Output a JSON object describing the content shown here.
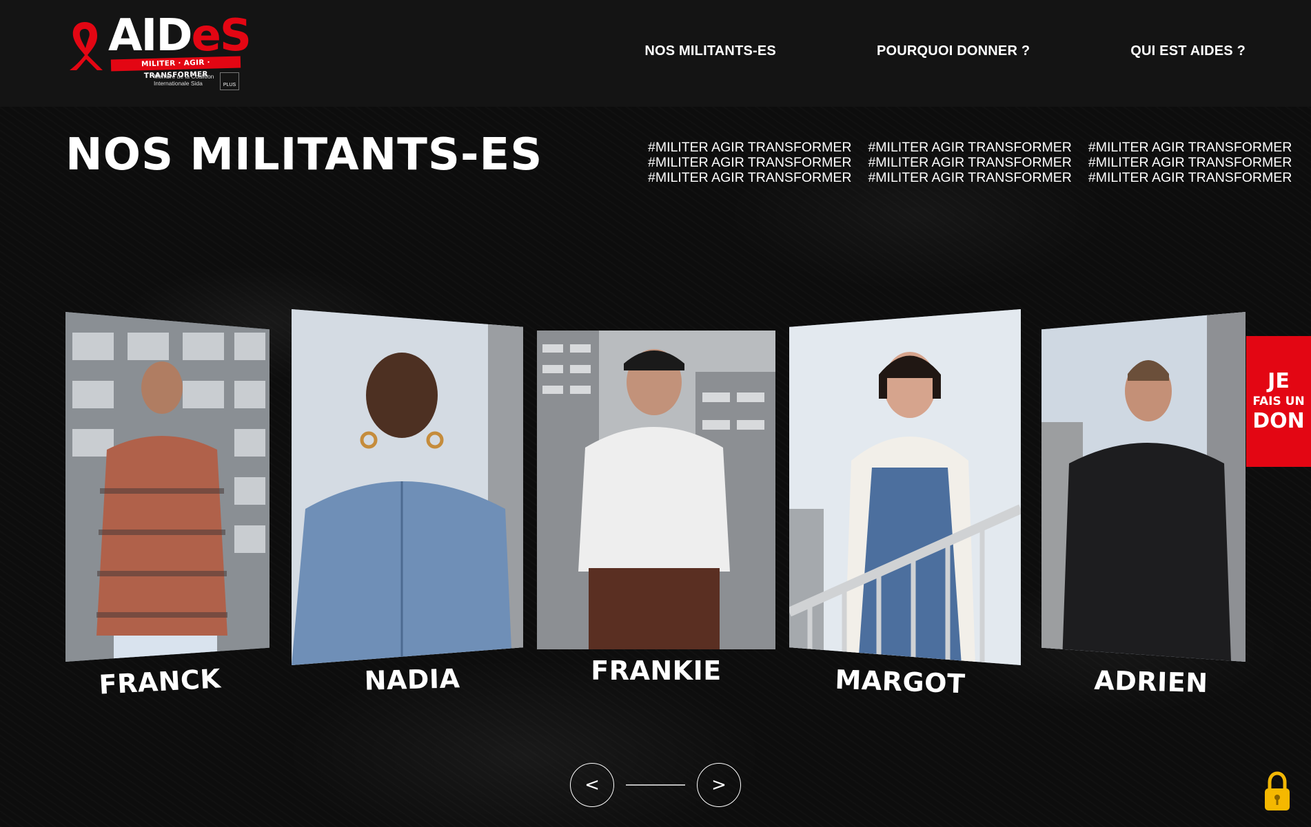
{
  "logo": {
    "wordmark_a": "AID",
    "wordmark_b": "eS",
    "tagline": "MILITER · AGIR · TRANSFORMER",
    "member_line1": "Membre de la Coalition",
    "member_line2": "Internationale Sida",
    "badge_text": "PLUS"
  },
  "nav": {
    "items": [
      "NOS MILITANTS-ES",
      "POURQUOI DONNER ?",
      "QUI EST AIDES ?"
    ]
  },
  "page": {
    "title": "NOS MILITANTS-ES",
    "hashtags": [
      "#MILITER AGIR TRANSFORMER",
      "#MILITER AGIR TRANSFORMER",
      "#MILITER AGIR TRANSFORMER",
      "#MILITER AGIR TRANSFORMER",
      "#MILITER AGIR TRANSFORMER",
      "#MILITER AGIR TRANSFORMER",
      "#MILITER AGIR TRANSFORMER",
      "#MILITER AGIR TRANSFORMER",
      "#MILITER AGIR TRANSFORMER"
    ]
  },
  "militants": [
    {
      "name": "FRANCK"
    },
    {
      "name": "NADIA"
    },
    {
      "name": "FRANKIE"
    },
    {
      "name": "MARGOT"
    },
    {
      "name": "ADRIEN"
    }
  ],
  "carousel": {
    "prev_label": "<",
    "next_label": ">"
  },
  "donate": {
    "line1": "JE",
    "line2": "FAIS UN",
    "line3": "DON"
  },
  "colors": {
    "brand_red": "#e30613",
    "background": "#0b0b0b",
    "header": "#141414"
  },
  "icons": [
    "ribbon-icon",
    "chevron-left-icon",
    "chevron-right-icon",
    "lock-icon"
  ]
}
